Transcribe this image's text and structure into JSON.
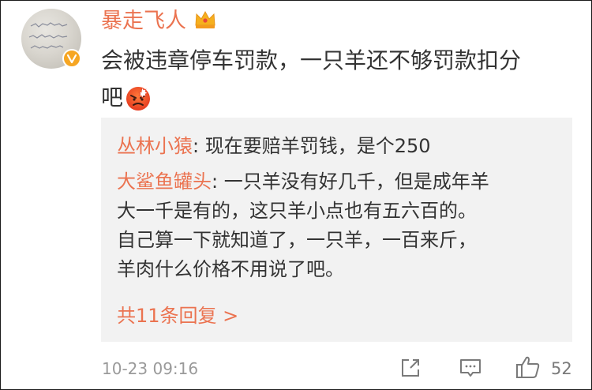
{
  "user": {
    "name": "暴走飞人"
  },
  "comment": {
    "line1": "会被违章停车罚款，一只羊还不够罚款扣分",
    "line2": "吧",
    "emoji": "angry-emoji"
  },
  "replies": [
    {
      "author": "丛林小猿",
      "sep": ": ",
      "text": "现在要赔羊罚钱，是个250"
    },
    {
      "author": "大鲨鱼罐头",
      "sep": ": ",
      "text_lines": [
        "一只羊没有好几千，但是成年羊",
        "大一千是有的，这只羊小点也有五六百的。",
        "自己算一下就知道了，一只羊，一百来斤，",
        "羊肉什么价格不用说了吧。"
      ]
    }
  ],
  "more_replies": "共11条回复 >",
  "meta": {
    "timestamp": "10-23 09:16",
    "like_count": "52"
  },
  "colors": {
    "accent": "#eb7350",
    "text": "#333333",
    "muted": "#9a9a9a",
    "quote_bg": "#f2f2f2"
  }
}
